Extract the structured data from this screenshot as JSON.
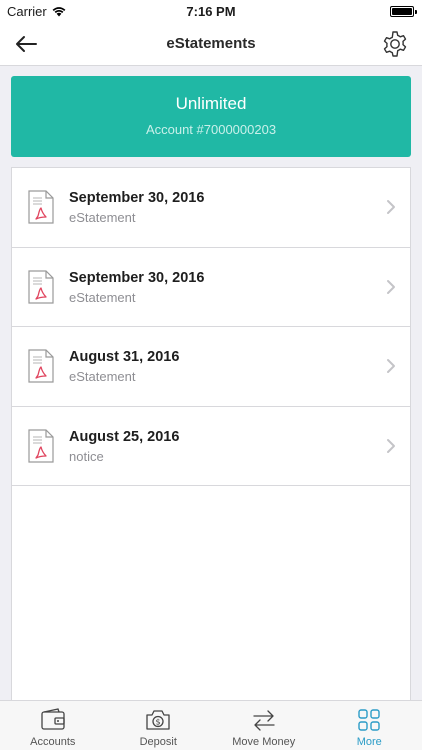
{
  "status_bar": {
    "carrier": "Carrier",
    "time": "7:16 PM"
  },
  "nav": {
    "title": "eStatements"
  },
  "banner": {
    "plan": "Unlimited",
    "account": "Account #7000000203"
  },
  "statements": [
    {
      "date": "September 30, 2016",
      "type": "eStatement"
    },
    {
      "date": "September 30, 2016",
      "type": "eStatement"
    },
    {
      "date": "August 31, 2016",
      "type": "eStatement"
    },
    {
      "date": "August 25, 2016",
      "type": "notice"
    }
  ],
  "tabs": [
    {
      "label": "Accounts",
      "icon": "wallet-icon"
    },
    {
      "label": "Deposit",
      "icon": "camera-icon"
    },
    {
      "label": "Move Money",
      "icon": "transfer-icon"
    },
    {
      "label": "More",
      "icon": "grid-icon",
      "active": true
    }
  ],
  "colors": {
    "accent": "#20b8a5",
    "tab_active": "#2b9cc7",
    "pdf": "#e0455f"
  }
}
